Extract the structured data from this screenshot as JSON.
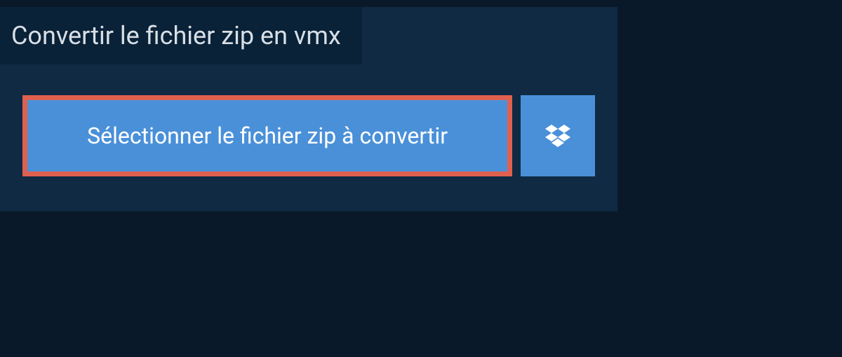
{
  "title": "Convertir le fichier zip en vmx",
  "select_button_label": "Sélectionner le fichier zip à convertir",
  "colors": {
    "background": "#0a1929",
    "panel": "#0f2a42",
    "tab": "#0a2238",
    "button": "#4a90d9",
    "highlight_border": "#e0604f",
    "text_light": "#d8dfe5",
    "text_white": "#ffffff"
  }
}
